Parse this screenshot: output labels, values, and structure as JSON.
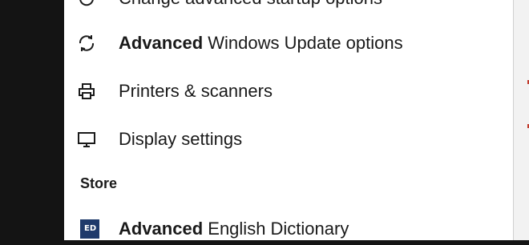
{
  "results": [
    {
      "bold": "",
      "rest": "Change advanced startup options",
      "icon": "power-icon"
    },
    {
      "bold": "Advanced",
      "rest": " Windows Update options",
      "icon": "sync-icon"
    },
    {
      "bold": "",
      "rest": "Printers & scanners",
      "icon": "printer-icon"
    },
    {
      "bold": "",
      "rest": "Display settings",
      "icon": "monitor-icon"
    }
  ],
  "store_section": "Store",
  "store_results": [
    {
      "bold": "Advanced",
      "rest": " English Dictionary",
      "icon": "dictionary-app-icon",
      "tile_text": "ED"
    }
  ]
}
